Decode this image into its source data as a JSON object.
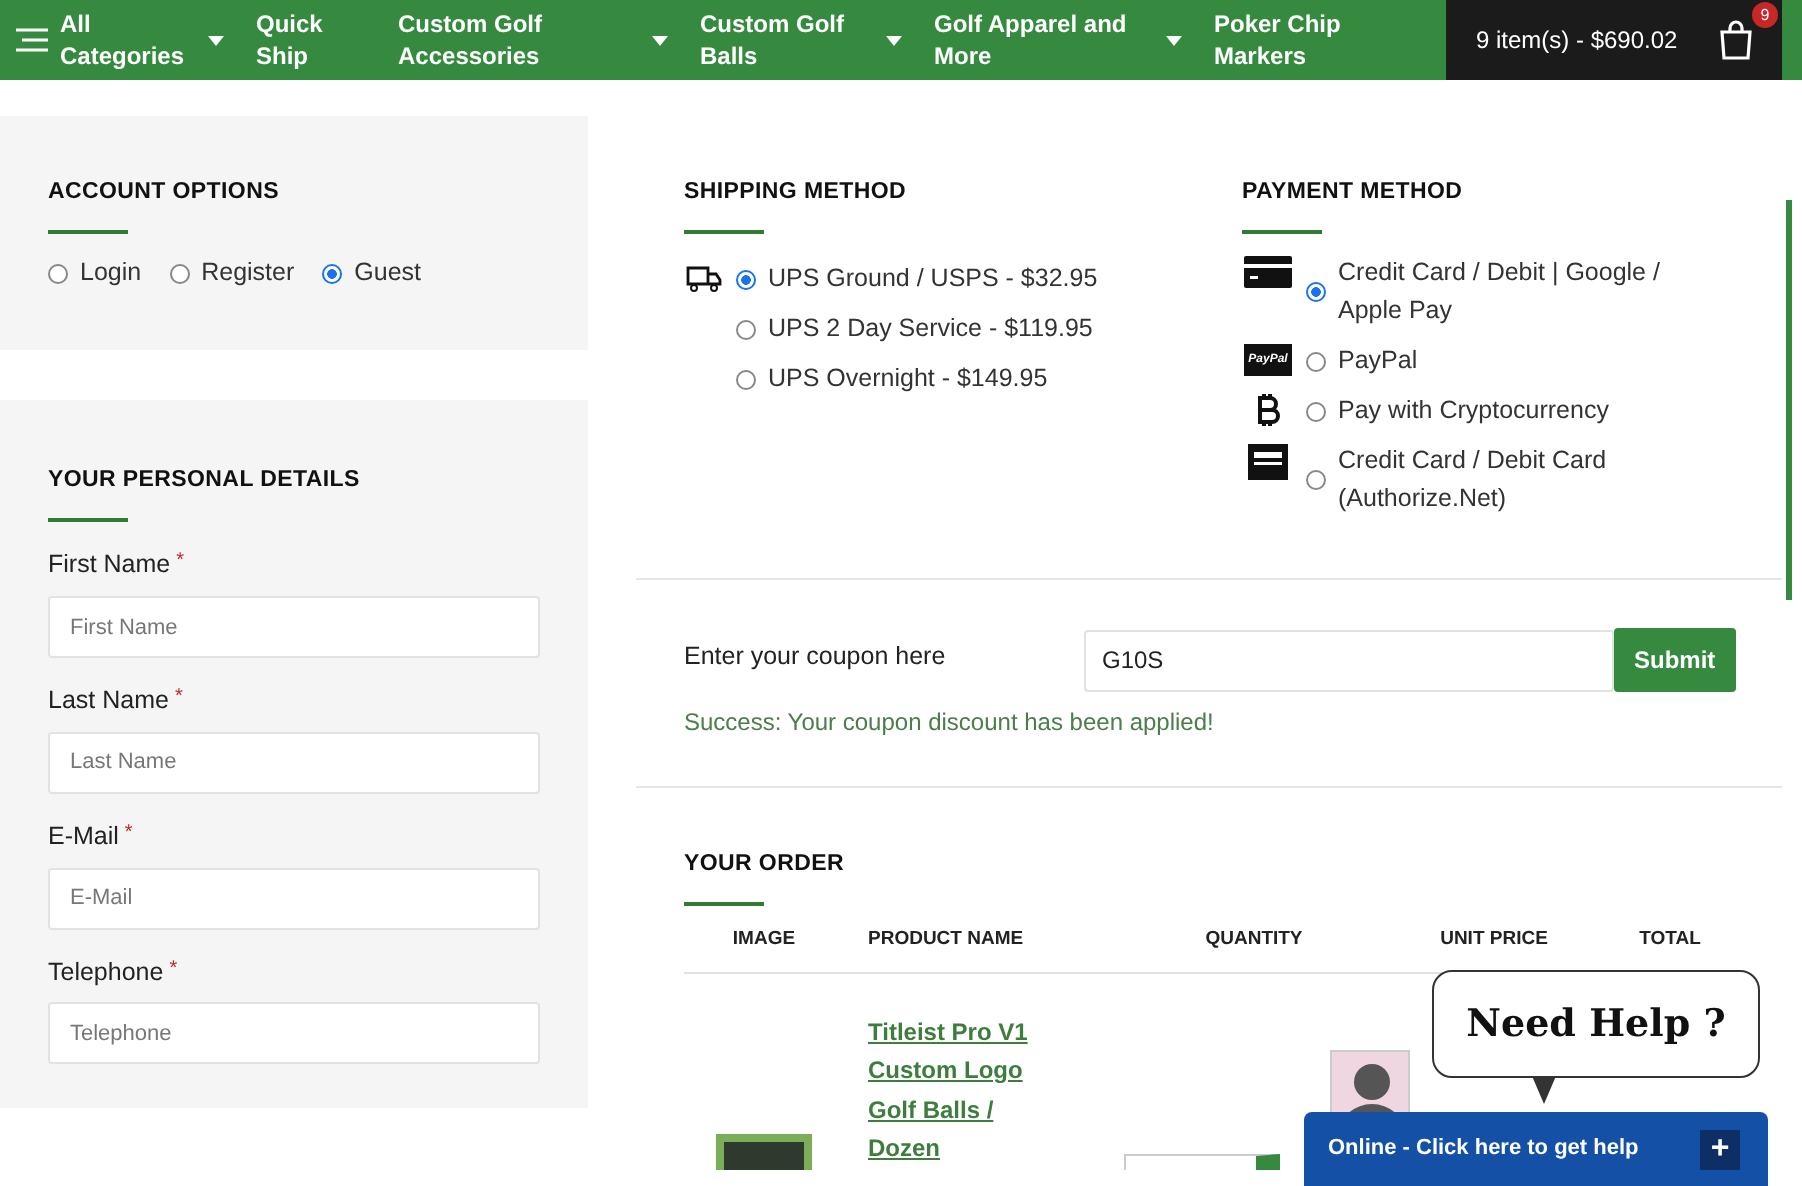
{
  "nav": {
    "items": [
      {
        "label": "All Categories",
        "kind": "menu",
        "dropdown": true
      },
      {
        "label": "Quick Ship",
        "kind": "link",
        "dropdown": false
      },
      {
        "label": "Custom Golf Accessories",
        "kind": "link",
        "dropdown": true
      },
      {
        "label": "Custom Golf Balls",
        "kind": "link",
        "dropdown": true
      },
      {
        "label": "Golf Apparel and More",
        "kind": "link",
        "dropdown": true
      },
      {
        "label": "Poker Chip Markers",
        "kind": "link",
        "dropdown": false
      }
    ],
    "cart": {
      "summary": "9 item(s) - $690.02",
      "badge": "9"
    }
  },
  "account_options": {
    "title": "ACCOUNT OPTIONS",
    "options": [
      {
        "label": "Login",
        "selected": false
      },
      {
        "label": "Register",
        "selected": false
      },
      {
        "label": "Guest",
        "selected": true
      }
    ]
  },
  "personal_details": {
    "title": "YOUR PERSONAL DETAILS",
    "fields": [
      {
        "label": "First Name",
        "required_mark": "*",
        "placeholder": "First Name"
      },
      {
        "label": "Last Name",
        "required_mark": "*",
        "placeholder": "Last Name"
      },
      {
        "label": "E-Mail",
        "required_mark": "*",
        "placeholder": "E-Mail"
      },
      {
        "label": "Telephone",
        "required_mark": "*",
        "placeholder": "Telephone"
      }
    ]
  },
  "shipping_method": {
    "title": "SHIPPING METHOD",
    "options": [
      {
        "label": "UPS Ground / USPS - $32.95",
        "selected": true
      },
      {
        "label": "UPS 2 Day Service - $119.95",
        "selected": false
      },
      {
        "label": "UPS Overnight - $149.95",
        "selected": false
      }
    ]
  },
  "payment_method": {
    "title": "PAYMENT METHOD",
    "options": [
      {
        "label": "Credit Card / Debit | Google / Apple Pay",
        "kind": "card",
        "selected": true
      },
      {
        "label": "PayPal",
        "kind": "paypal",
        "logo_text": "PayPal",
        "selected": false
      },
      {
        "label": "Pay with Cryptocurrency",
        "kind": "bitcoin",
        "selected": false
      },
      {
        "label": "Credit Card / Debit Card (Authorize.Net)",
        "kind": "terminal",
        "selected": false
      }
    ]
  },
  "coupon": {
    "label": "Enter your coupon here",
    "value": "G10S",
    "button": "Submit",
    "message": "Success: Your coupon discount has been applied!"
  },
  "order": {
    "title": "YOUR ORDER",
    "columns": [
      "IMAGE",
      "PRODUCT NAME",
      "QUANTITY",
      "UNIT PRICE",
      "TOTAL"
    ],
    "rows": [
      {
        "product": "Titleist Pro V1 Custom Logo Golf Balls / Dozen"
      }
    ]
  },
  "chat": {
    "bubble": "Need Help ?",
    "bar": "Online - Click here to get help",
    "button": "+"
  }
}
